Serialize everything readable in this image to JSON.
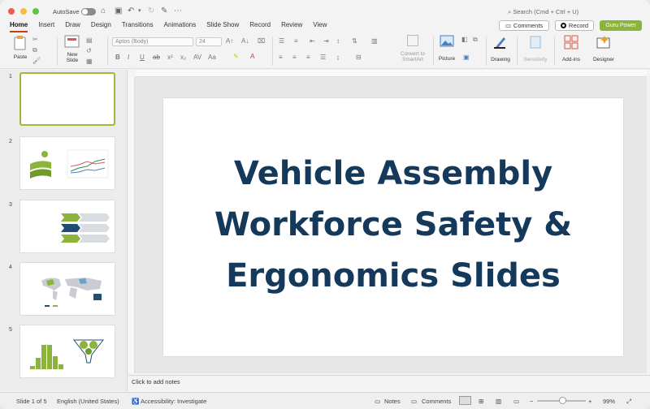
{
  "window": {
    "autosave_label": "AutoSave",
    "search_placeholder": "Search (Cmd + Ctrl + U)"
  },
  "tabs": [
    "Home",
    "Insert",
    "Draw",
    "Design",
    "Transitions",
    "Animations",
    "Slide Show",
    "Record",
    "Review",
    "View"
  ],
  "header_buttons": {
    "comments": "Comments",
    "record": "Record",
    "guru": "Guru Power"
  },
  "ribbon": {
    "paste": "Paste",
    "new_slide": [
      "New",
      "Slide"
    ],
    "font_name": "Aptos (Body)",
    "font_size": "24",
    "convert_smartart": [
      "Convert to",
      "SmartArt"
    ],
    "picture": "Picture",
    "drawing": "Drawing",
    "sensitivity": "Sensitivity",
    "addins": "Add-ins",
    "designer": "Designer"
  },
  "slides": [
    {
      "num": "1",
      "selected": true
    },
    {
      "num": "2"
    },
    {
      "num": "3"
    },
    {
      "num": "4"
    },
    {
      "num": "5"
    }
  ],
  "slide_title": [
    "Vehicle Assembly",
    "Workforce Safety &",
    "Ergonomics Slides"
  ],
  "notes_placeholder": "Click to add notes",
  "status": {
    "slide_count": "Slide 1 of 5",
    "language": "English (United States)",
    "accessibility": "Accessibility: Investigate",
    "notes": "Notes",
    "comments": "Comments",
    "zoom": "99%"
  },
  "colors": {
    "accent_tab": "#c2410c",
    "guru_green": "#8cb43a",
    "title_navy": "#14395a",
    "selection": "#9eb83a"
  }
}
